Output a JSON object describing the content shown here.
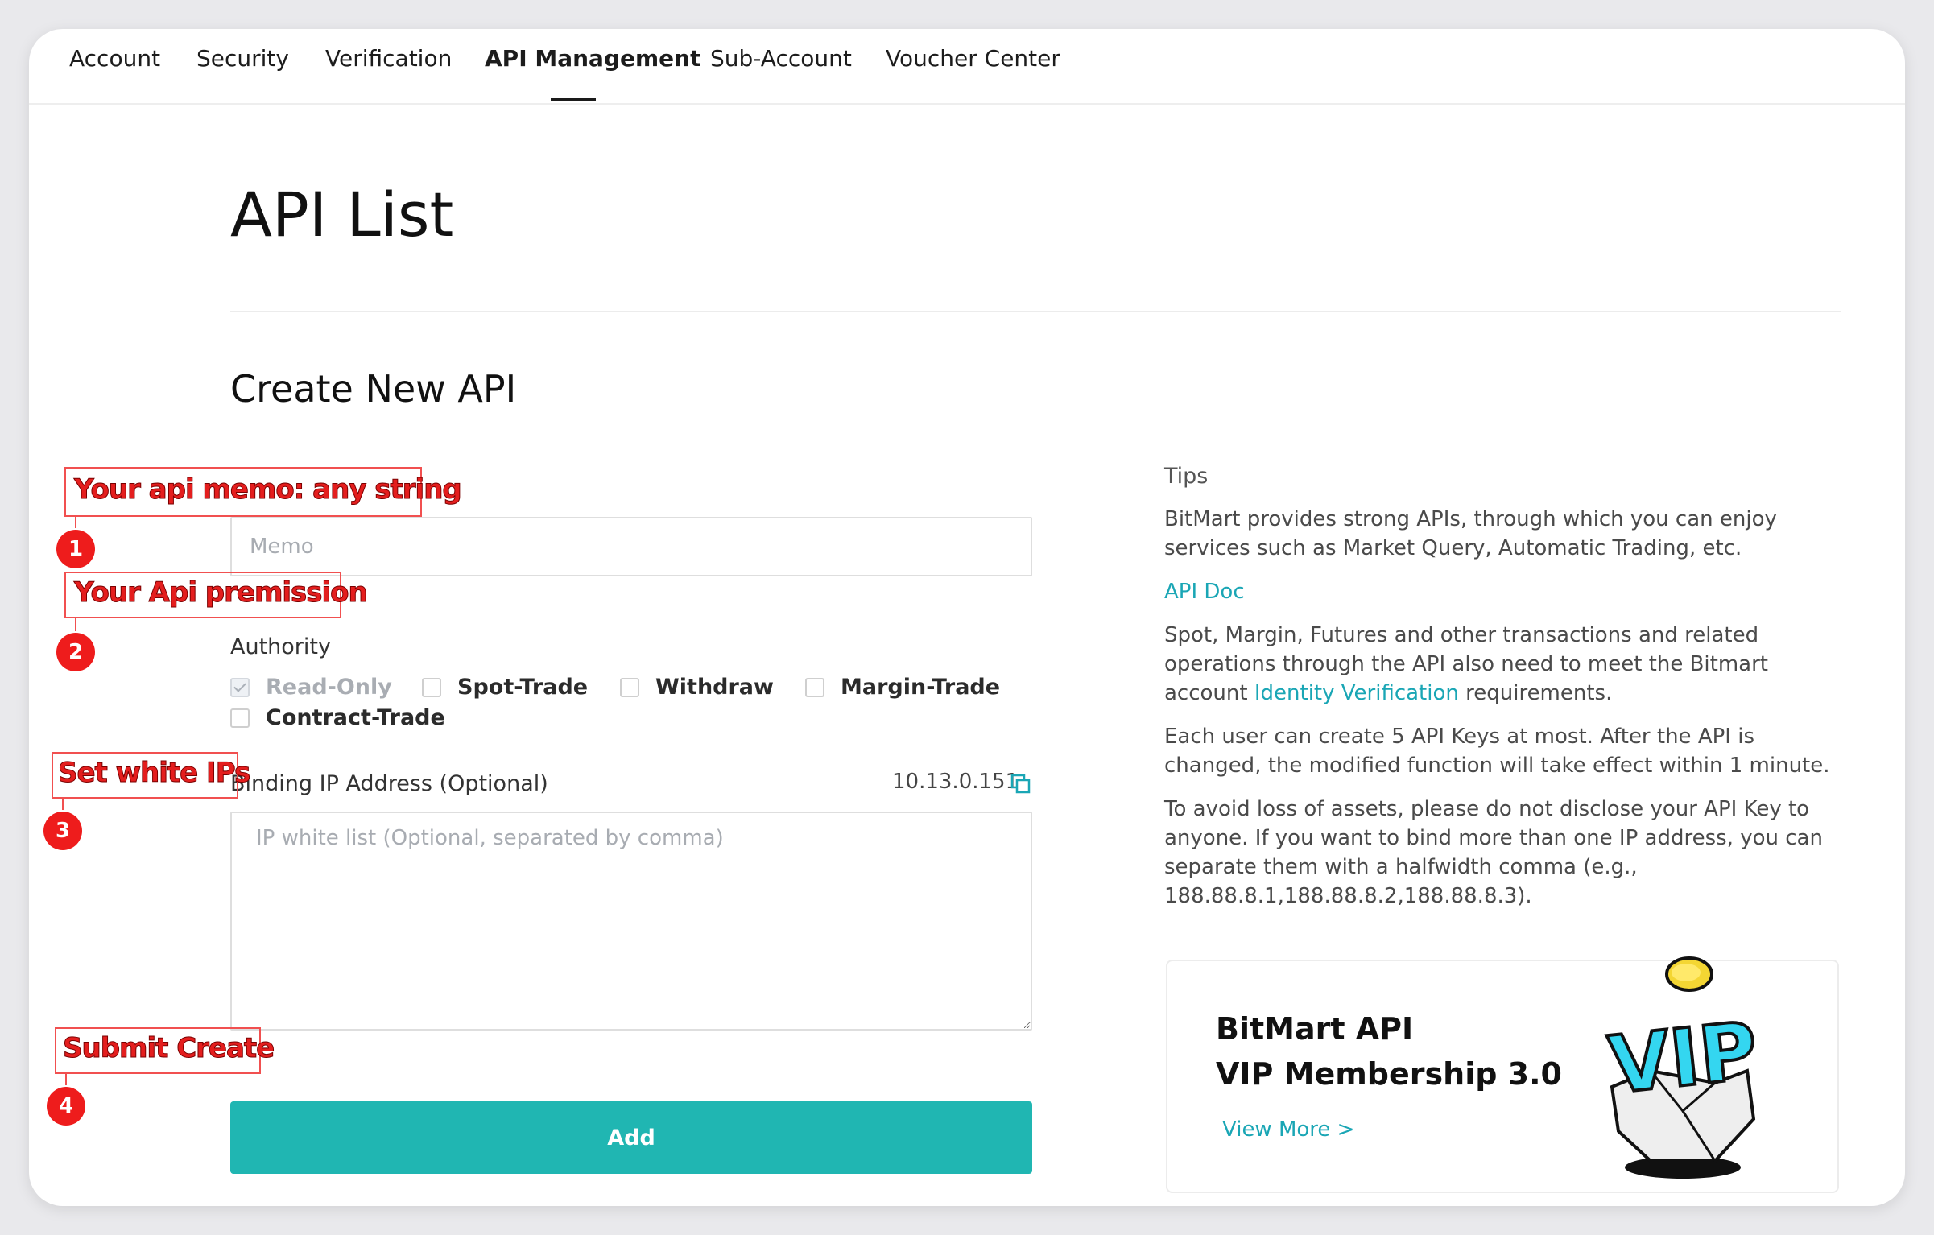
{
  "tabs": [
    {
      "label": "Account"
    },
    {
      "label": "Security"
    },
    {
      "label": "Verification"
    },
    {
      "label": "API Management",
      "active": true
    },
    {
      "label": "Sub-Account"
    },
    {
      "label": "Voucher Center"
    }
  ],
  "page_title": "API List",
  "section_title": "Create New API",
  "form": {
    "memo_placeholder": "Memo",
    "memo_value": "",
    "authority_label": "Authority",
    "permissions": [
      {
        "label": "Read-Only",
        "checked": true,
        "disabled": true
      },
      {
        "label": "Spot-Trade",
        "checked": false
      },
      {
        "label": "Withdraw",
        "checked": false
      },
      {
        "label": "Margin-Trade",
        "checked": false
      },
      {
        "label": "Contract-Trade",
        "checked": false
      }
    ],
    "ip_label": "Binding IP Address (Optional)",
    "current_ip": "10.13.0.151",
    "ip_placeholder": "IP white list (Optional, separated by comma)",
    "add_label": "Add"
  },
  "tips": {
    "title": "Tips",
    "p1": "BitMart provides strong APIs, through which you can enjoy services such as Market Query, Automatic Trading, etc.",
    "api_doc_link": "API Doc",
    "p2_before": "Spot, Margin, Futures and other transactions and related operations through the API also need to meet the Bitmart account ",
    "p2_link": "Identity Verification",
    "p2_after": " requirements.",
    "p3": "Each user can create 5 API Keys at most. After the API is changed, the modified function will take effect within 1 minute.",
    "p4": "To avoid loss of assets, please do not disclose your API Key to anyone. If you want to bind more than one IP address, you can separate them with a halfwidth comma (e.g., 188.88.8.1,188.88.8.2,188.88.8.3)."
  },
  "vip_card": {
    "line1": "BitMart API",
    "line2": "VIP Membership 3.0",
    "link": "View More >",
    "art_text": "VIP"
  },
  "annotations": [
    {
      "num": "1",
      "text": "Your api memo: any string"
    },
    {
      "num": "2",
      "text": "Your Api premission"
    },
    {
      "num": "3",
      "text": "Set white IPs"
    },
    {
      "num": "4",
      "text": "Submit Create"
    }
  ],
  "colors": {
    "accent": "#20b6b2",
    "link": "#1aa6b5",
    "annotation": "#ee1c1c"
  }
}
